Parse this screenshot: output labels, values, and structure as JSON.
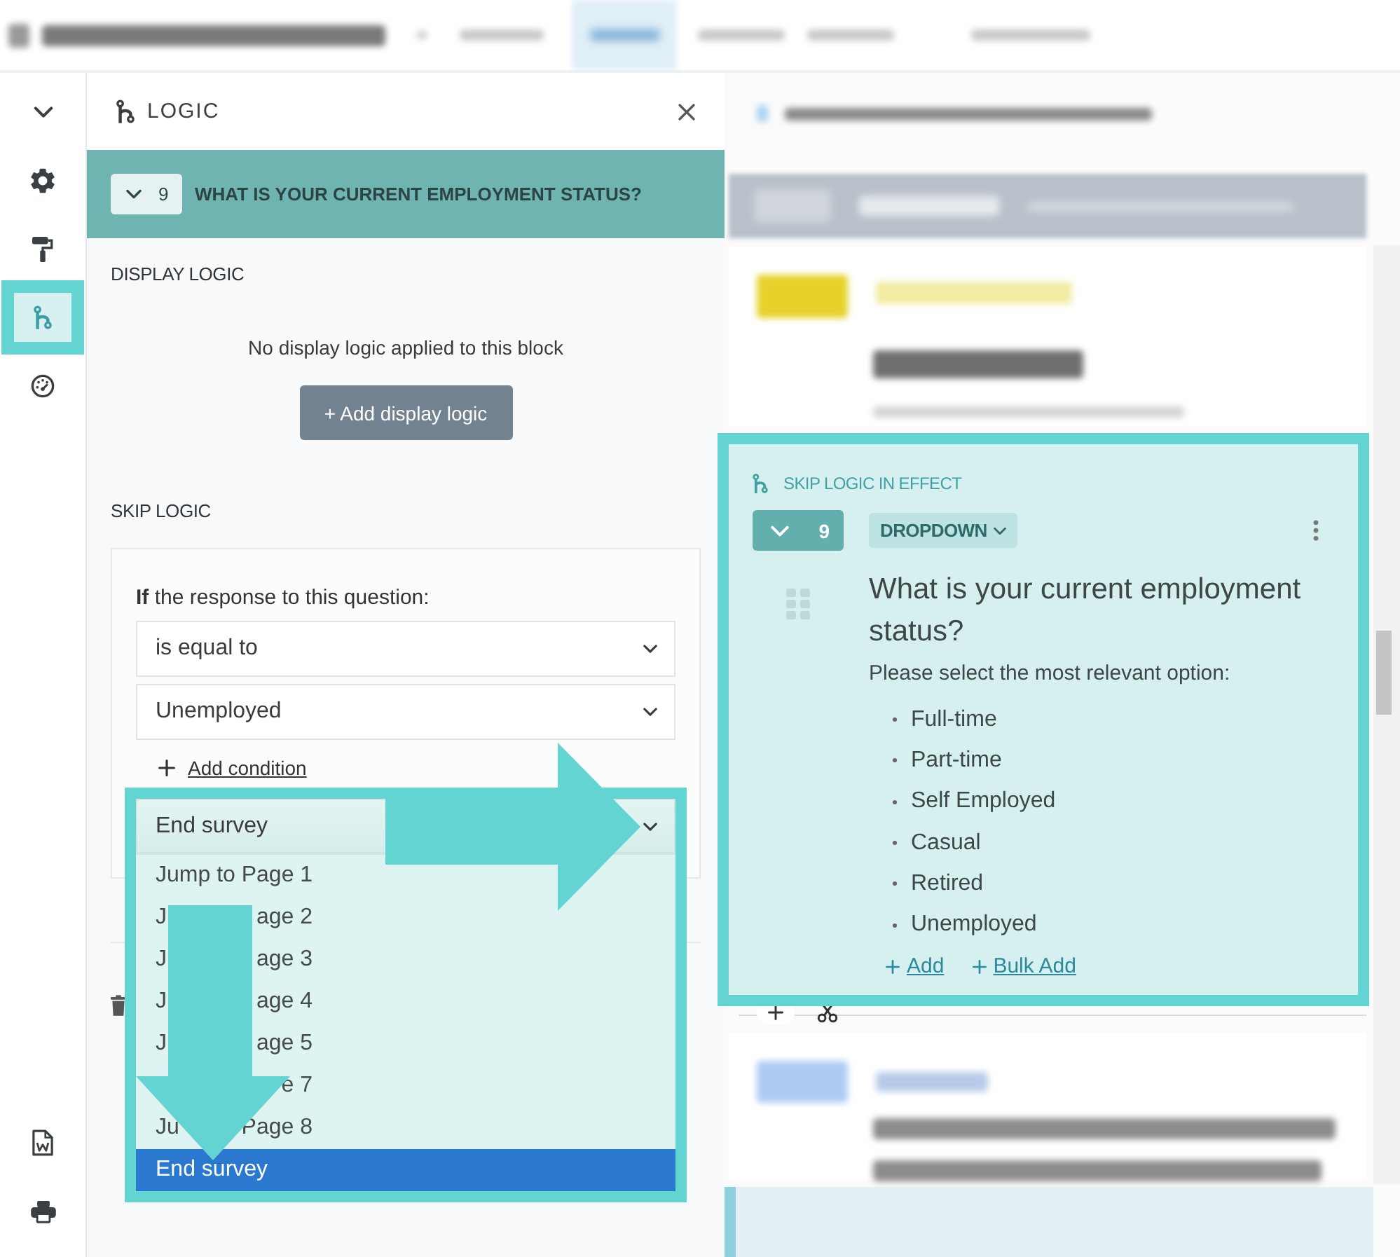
{
  "sidebar": {
    "items": [
      {
        "kind": "collapse",
        "selected": false,
        "highlighted": false
      },
      {
        "kind": "settings",
        "selected": false,
        "highlighted": false
      },
      {
        "kind": "design",
        "selected": false,
        "highlighted": false
      },
      {
        "kind": "logic",
        "selected": true,
        "highlighted": true
      },
      {
        "kind": "dashboard",
        "selected": false,
        "highlighted": false
      }
    ],
    "bottom_items": [
      {
        "kind": "word_export"
      },
      {
        "kind": "print"
      }
    ]
  },
  "logic_panel": {
    "title": "LOGIC",
    "block": {
      "number": "9",
      "title": "WHAT IS YOUR CURRENT EMPLOYMENT STATUS?"
    },
    "display_logic": {
      "heading": "DISPLAY LOGIC",
      "empty_message": "No display logic applied to this block",
      "add_button": "+ Add display logic"
    },
    "skip_logic": {
      "heading": "SKIP LOGIC",
      "condition_label": "**If** the response to this question:",
      "operator": "is equal to",
      "answer": "Unemployed",
      "add_condition": "Add condition",
      "action": {
        "value": "End survey",
        "expanded": true,
        "highlighted": true,
        "options": [
          {
            "start": "Jump to Page 1",
            "selected": false
          },
          {
            "start": "J",
            "end": "age 2",
            "selected": false
          },
          {
            "start": "J",
            "end": "age 3",
            "selected": false
          },
          {
            "start": "J",
            "end": "age 4",
            "selected": false
          },
          {
            "start": "J",
            "end": "age 5",
            "selected": false
          },
          {
            "end": "e 7",
            "selected": false
          },
          {
            "start": "Ju",
            "end": "Page 8",
            "selected": false
          },
          {
            "start": "End survey",
            "selected": true
          }
        ]
      }
    }
  },
  "question_card": {
    "highlighted": true,
    "notice": "SKIP LOGIC IN EFFECT",
    "number": "9",
    "type": "DROPDOWN",
    "title": "What is your current employment status?",
    "description": "Please select the most relevant option:",
    "options": [
      "Full-time",
      "Part-time",
      "Self Employed",
      "Casual",
      "Retired",
      "Unemployed"
    ],
    "links": [
      "Add",
      "Bulk Add"
    ]
  },
  "annotation_arrows": {
    "right": true,
    "down": true
  }
}
